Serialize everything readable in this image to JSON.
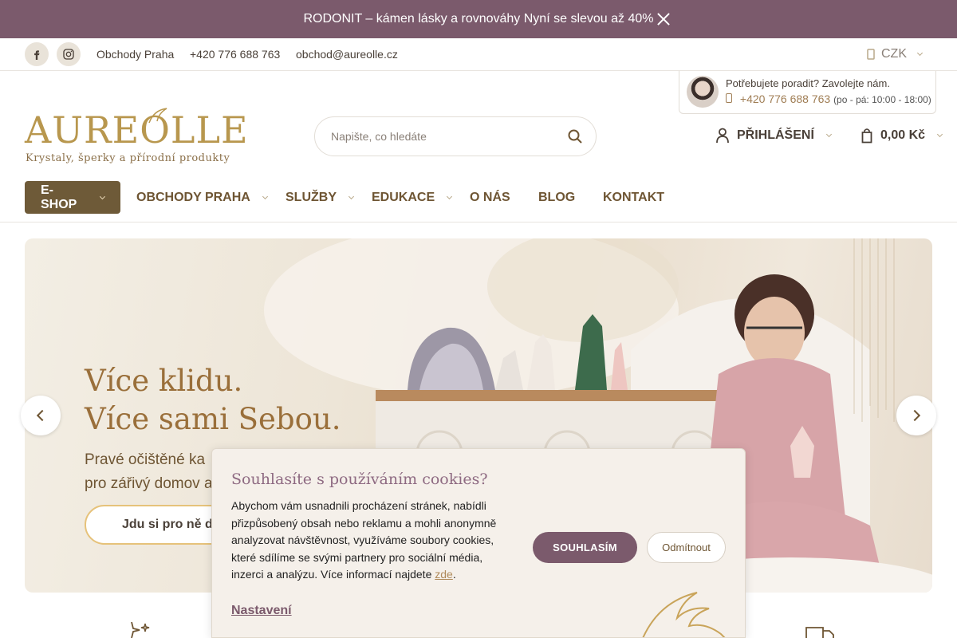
{
  "announcement": {
    "text": "RODONIT – kámen lásky a rovnováhy  Nyní se slevou až 40%"
  },
  "topbar": {
    "stores": "Obchody Praha",
    "phone": "+420 776 688 763",
    "email": "obchod@aureolle.cz",
    "currency": "CZK"
  },
  "advisor": {
    "question": "Potřebujete poradit? Zavolejte nám.",
    "phone": "+420 776 688 763",
    "hours": "(po - pá: 10:00 - 18:00)"
  },
  "logo": {
    "word": "AUREOLLE",
    "tagline": "Krystaly, šperky a přírodní produkty"
  },
  "search": {
    "placeholder": "Napište, co hledáte"
  },
  "account": {
    "login_label": "PŘIHLÁŠENÍ",
    "cart_total": "0,00 Kč"
  },
  "nav": {
    "items": [
      "E-SHOP",
      "OBCHODY PRAHA",
      "SLUŽBY",
      "EDUKACE",
      "O NÁS",
      "BLOG",
      "KONTAKT"
    ]
  },
  "hero": {
    "headline_1": "Více klidu.",
    "headline_2": "Více sami Sebou.",
    "sub_1": "Pravé očištěné ka",
    "sub_2": "pro zářivý domov a",
    "cta": "Jdu si pro ně d"
  },
  "cookie": {
    "title": "Souhlasíte s používáním cookies?",
    "body": "Abychom vám usnadnili procházení stránek, nabídli přizpůsobený obsah nebo reklamu a mohli anonymně analyzovat návštěvnost, využíváme soubory cookies, které sdílíme se svými partnery pro sociální média, inzerci a analýzu. Více informací najdete ",
    "link": "zde",
    "accept": "SOUHLASÍM",
    "deny": "Odmítnout",
    "settings": "Nastavení"
  },
  "colors": {
    "brand_plum": "#7b5a6c",
    "brand_gold": "#b8974e",
    "brand_brown": "#6e5a38"
  }
}
